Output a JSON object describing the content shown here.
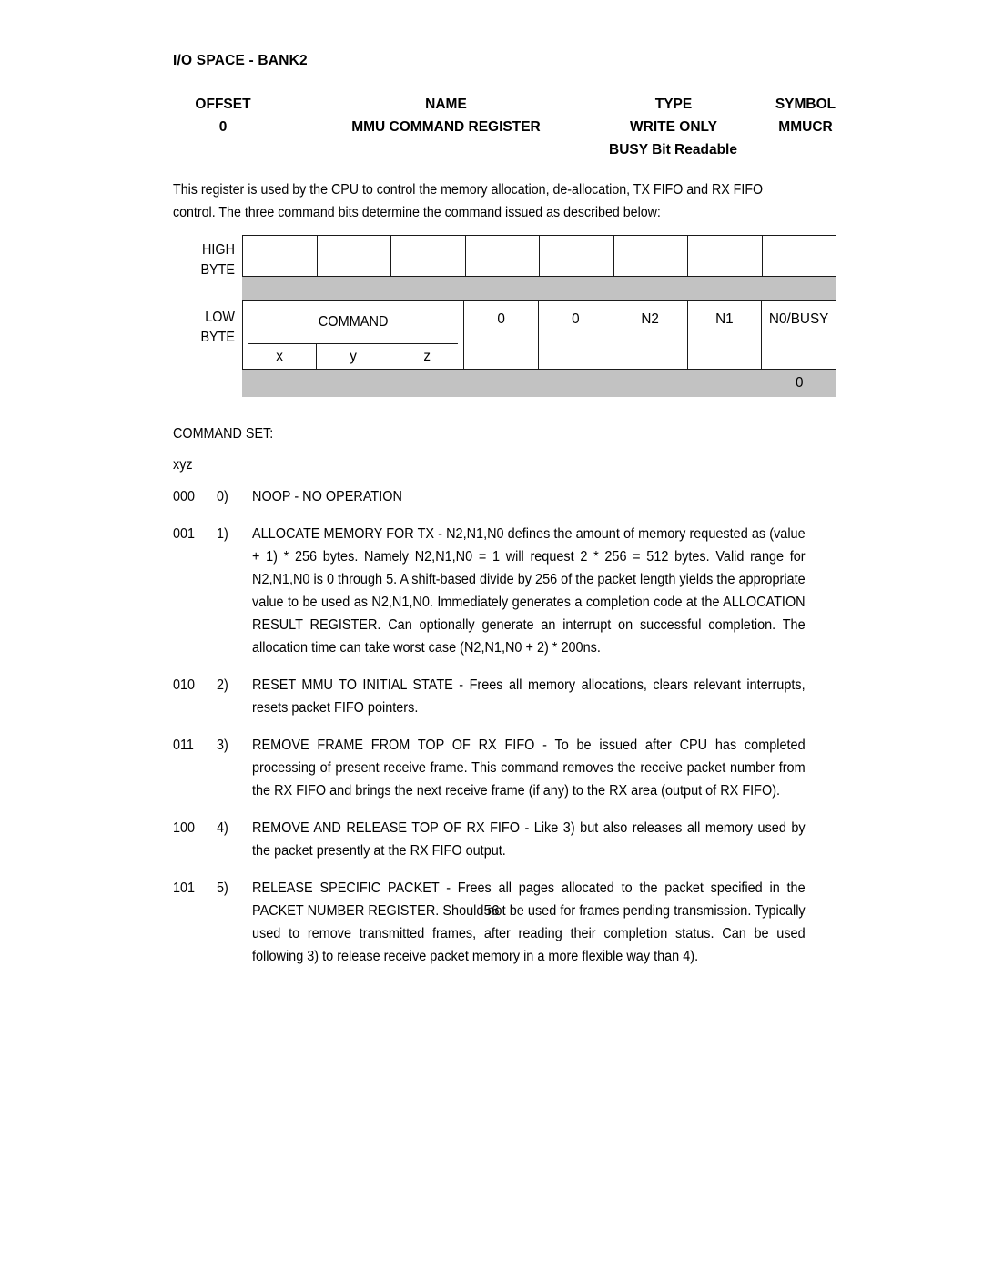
{
  "document": {
    "bank_title": "I/O SPACE - BANK2",
    "page_number": "56"
  },
  "register_header": {
    "columns": [
      "OFFSET",
      "NAME",
      "TYPE",
      "SYMBOL"
    ],
    "values": [
      "0",
      "MMU COMMAND REGISTER",
      "WRITE ONLY",
      "MMUCR"
    ],
    "type_note": "BUSY Bit Readable"
  },
  "intro": {
    "line1": "This register is used by the CPU to control the memory allocation, de-allocation, TX FIFO and RX FIFO",
    "line2": "control. The three command bits determine the command issued as described below:"
  },
  "diagram": {
    "high_byte_label_line1": "HIGH",
    "high_byte_label_line2": "BYTE",
    "low_byte_label_line1": "LOW",
    "low_byte_label_line2": "BYTE",
    "high_byte_cells": [
      "",
      "",
      "",
      "",
      "",
      "",
      "",
      ""
    ],
    "command_label": "COMMAND",
    "command_subcells": [
      "x",
      "y",
      "z"
    ],
    "low_byte_cells": [
      "0",
      "0",
      "N2",
      "N1",
      "N0/BUSY"
    ],
    "bottom_band_value": "0",
    "band_color": "#c2c2c2",
    "border_color": "#1a1a1a"
  },
  "command_set": {
    "title": "COMMAND SET:",
    "bits_header": "xyz",
    "items": [
      {
        "bits": "000",
        "index": "0)",
        "text": "NOOP - NO OPERATION",
        "justified": false
      },
      {
        "bits": "001",
        "index": "1)",
        "text": "ALLOCATE MEMORY FOR TX - N2,N1,N0 defines the amount of memory requested as (value + 1) * 256 bytes. Namely N2,N1,N0 = 1 will request 2 * 256 = 512 bytes. Valid range for N2,N1,N0 is 0 through 5. A shift-based divide by 256 of the packet length yields the appropriate value to be used as N2,N1,N0. Immediately generates a completion code at the ALLOCATION RESULT REGISTER. Can optionally generate an interrupt on successful completion. The allocation time can take worst case (N2,N1,N0 + 2) * 200ns.",
        "justified": true
      },
      {
        "bits": "010",
        "index": "2)",
        "text": "RESET MMU TO INITIAL STATE - Frees all memory allocations, clears relevant interrupts, resets packet FIFO pointers.",
        "justified": true
      },
      {
        "bits": "011",
        "index": "3)",
        "text": "REMOVE FRAME FROM TOP OF RX FIFO - To be issued after CPU has completed processing of present receive frame. This command removes the receive packet number from the RX FIFO and brings the next receive frame (if any) to the RX area (output of RX FIFO).",
        "justified": true
      },
      {
        "bits": "100",
        "index": "4)",
        "text": "REMOVE AND RELEASE TOP OF RX FIFO - Like 3) but also releases all memory used by the packet presently at the RX FIFO output.",
        "justified": true
      },
      {
        "bits": "101",
        "index": "5)",
        "text": "RELEASE SPECIFIC PACKET - Frees all pages allocated to the packet specified in the PACKET NUMBER REGISTER. Should not be used for frames pending transmission. Typically used to remove transmitted frames, after reading their completion status.  Can be used following 3) to release receive packet memory in a more flexible way than 4).",
        "justified": true
      }
    ]
  }
}
